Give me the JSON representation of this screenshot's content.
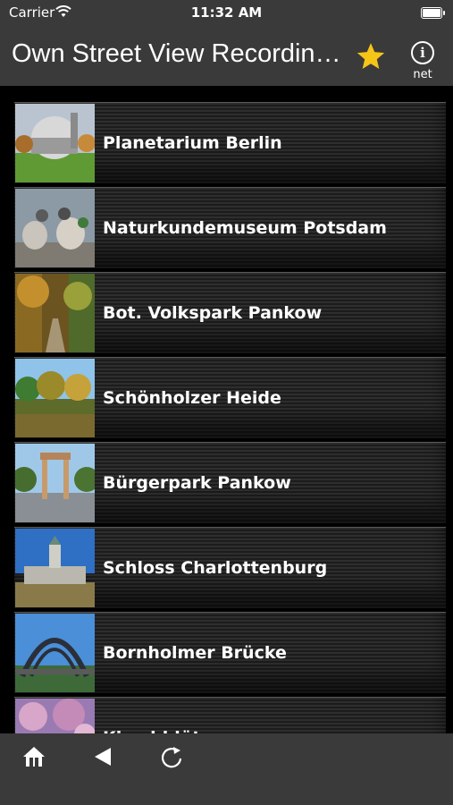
{
  "status": {
    "carrier": "Carrier",
    "time": "11:32 AM"
  },
  "nav": {
    "title": "Own Street View Recordin…",
    "info_sub": "net",
    "info_glyph": "i",
    "star_color": "#f5c518"
  },
  "items": [
    {
      "label": "Planetarium Berlin",
      "icon": "planetarium-photo"
    },
    {
      "label": "Naturkundemuseum Potsdam",
      "icon": "birds-photo"
    },
    {
      "label": "Bot. Volkspark Pankow",
      "icon": "park-path-photo"
    },
    {
      "label": "Schönholzer Heide",
      "icon": "forest-photo"
    },
    {
      "label": "Bürgerpark Pankow",
      "icon": "gate-photo"
    },
    {
      "label": "Schloss Charlottenburg",
      "icon": "palace-photo"
    },
    {
      "label": "Bornholmer Brücke",
      "icon": "bridge-photo"
    },
    {
      "label": "Kirschblüten",
      "icon": "cherry-blossom-photo"
    }
  ],
  "toolbar": {
    "home": "home-icon",
    "back": "back-arrow-icon",
    "reload": "reload-icon"
  }
}
